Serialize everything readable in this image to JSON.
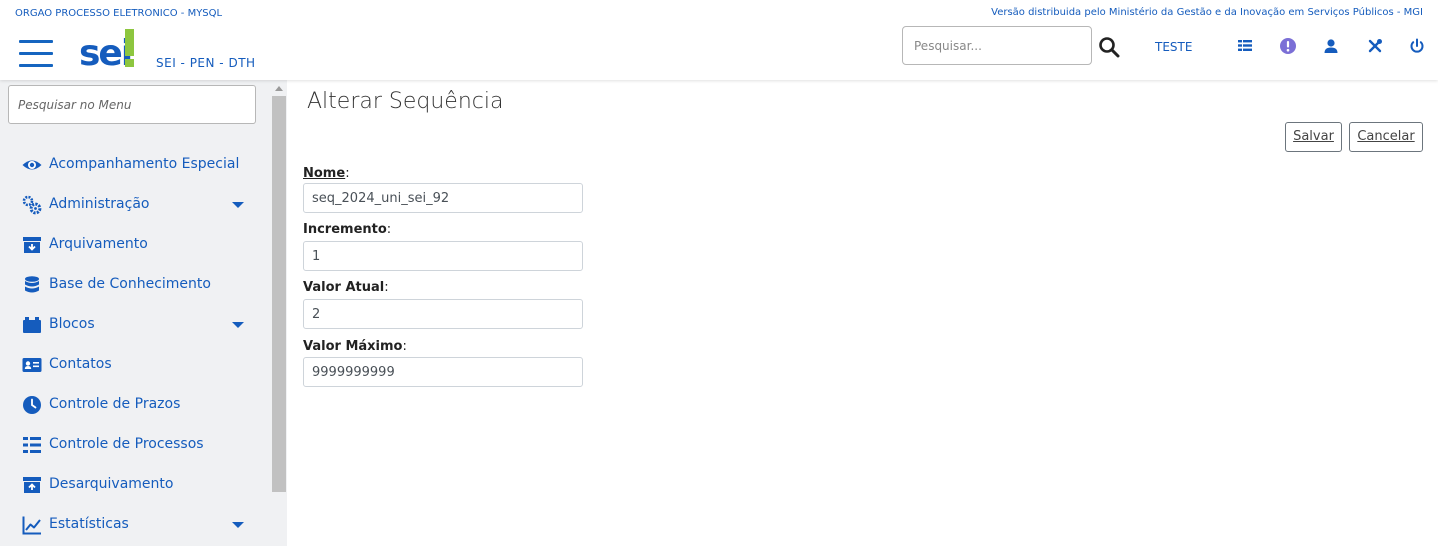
{
  "header": {
    "org_name": "ORGAO PROCESSO ELETRONICO - MYSQL",
    "version_text": "Versão distribuida pelo Ministério da Gestão e da Inovação em Serviços Públicos - MGI",
    "logo_text": "sei!",
    "system_subtitle": "SEI - PEN - DTH",
    "search_placeholder": "Pesquisar...",
    "unit": "TESTE",
    "icons": [
      "menu-icon",
      "search-icon",
      "tasks-icon",
      "notice-icon",
      "user-icon",
      "tools-icon",
      "power-icon"
    ]
  },
  "sidebar": {
    "search_placeholder": "Pesquisar no Menu",
    "items": [
      {
        "label": "Acompanhamento Especial",
        "icon": "eye-icon",
        "expandable": false
      },
      {
        "label": "Administração",
        "icon": "gears-icon",
        "expandable": true
      },
      {
        "label": "Arquivamento",
        "icon": "archive-icon",
        "expandable": false
      },
      {
        "label": "Base de Conhecimento",
        "icon": "database-icon",
        "expandable": false
      },
      {
        "label": "Blocos",
        "icon": "blocks-icon",
        "expandable": true
      },
      {
        "label": "Contatos",
        "icon": "contact-card-icon",
        "expandable": false
      },
      {
        "label": "Controle de Prazos",
        "icon": "clock-icon",
        "expandable": false
      },
      {
        "label": "Controle de Processos",
        "icon": "list-icon",
        "expandable": false
      },
      {
        "label": "Desarquivamento",
        "icon": "unarchive-icon",
        "expandable": false
      },
      {
        "label": "Estatísticas",
        "icon": "chart-icon",
        "expandable": true
      }
    ]
  },
  "main": {
    "title": "Alterar Sequência",
    "save_label": "Salvar",
    "cancel_label": "Cancelar",
    "fields": [
      {
        "label": "Nome",
        "value": "seq_2024_uni_sei_92"
      },
      {
        "label": "Incremento",
        "value": "1"
      },
      {
        "label": "Valor Atual",
        "value": "2"
      },
      {
        "label": "Valor Máximo",
        "value": "9999999999"
      }
    ]
  },
  "colors": {
    "accent": "#155cbd",
    "logo_green": "#8dc63f",
    "sidebar_bg": "#f0f1f3"
  }
}
